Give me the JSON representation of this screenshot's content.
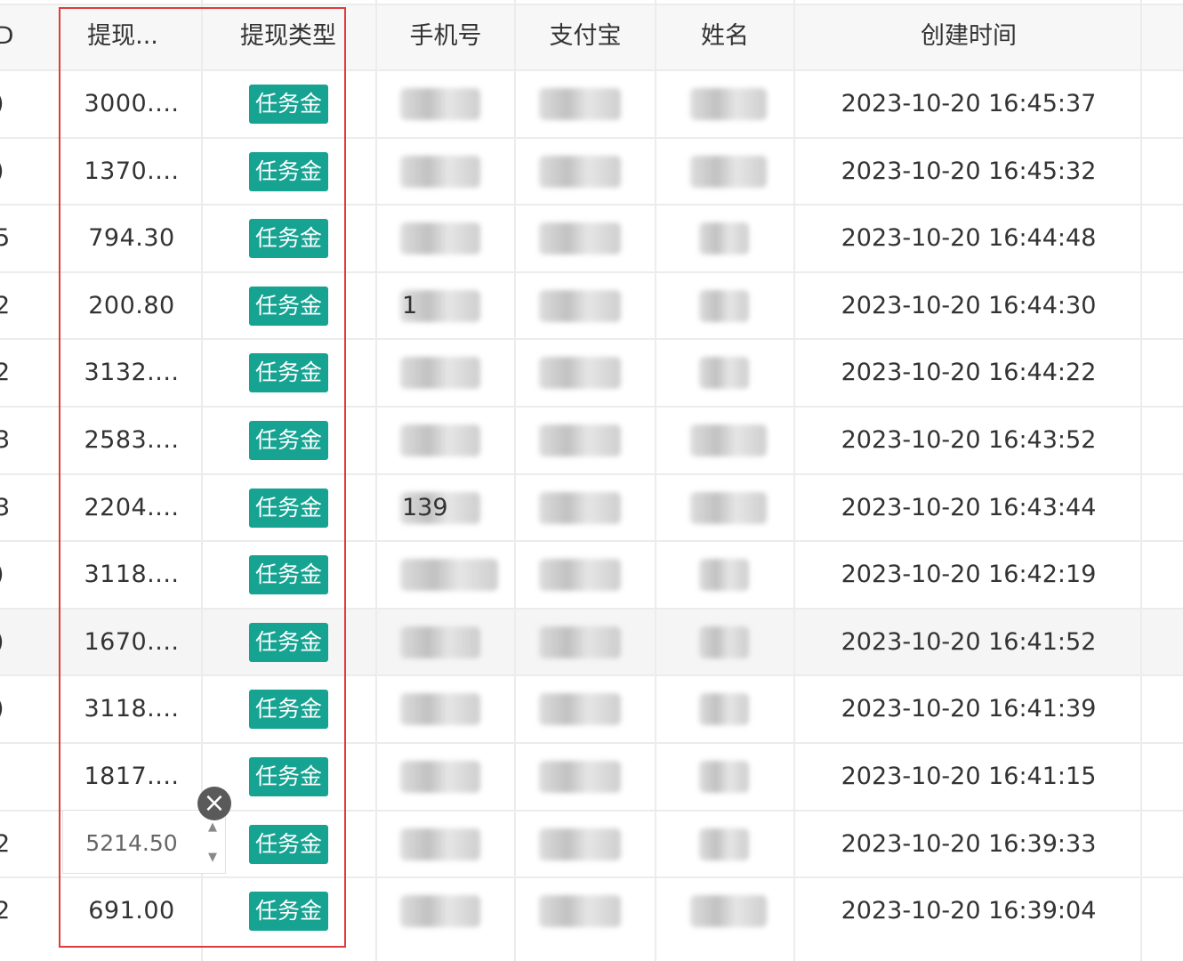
{
  "table": {
    "columns": {
      "id": "D",
      "amount": "提现...",
      "type": "提现类型",
      "phone": "手机号",
      "alipay": "支付宝",
      "name": "姓名",
      "created": "创建时间"
    },
    "rows": [
      {
        "id_tail": ")",
        "amount": "3000....",
        "type": "任务金",
        "phone_visible": "",
        "alipay_visible": "",
        "name_visible": "",
        "created": "2023-10-20 16:45:37"
      },
      {
        "id_tail": ")",
        "amount": "1370....",
        "type": "任务金",
        "phone_visible": "",
        "alipay_visible": "",
        "name_visible": "",
        "created": "2023-10-20 16:45:32"
      },
      {
        "id_tail": "5",
        "amount": "794.30",
        "type": "任务金",
        "phone_visible": "",
        "alipay_visible": "",
        "name_visible": "",
        "created": "2023-10-20 16:44:48"
      },
      {
        "id_tail": "2",
        "amount": "200.80",
        "type": "任务金",
        "phone_visible": "1",
        "alipay_visible": "",
        "name_visible": "",
        "created": "2023-10-20 16:44:30"
      },
      {
        "id_tail": "2",
        "amount": "3132....",
        "type": "任务金",
        "phone_visible": "",
        "alipay_visible": "",
        "name_visible": "",
        "created": "2023-10-20 16:44:22"
      },
      {
        "id_tail": "3",
        "amount": "2583....",
        "type": "任务金",
        "phone_visible": "",
        "alipay_visible": "",
        "name_visible": "",
        "created": "2023-10-20 16:43:52"
      },
      {
        "id_tail": "3",
        "amount": "2204....",
        "type": "任务金",
        "phone_visible": "139",
        "alipay_visible": "",
        "name_visible": "",
        "created": "2023-10-20 16:43:44"
      },
      {
        "id_tail": ")",
        "amount": "3118....",
        "type": "任务金",
        "phone_visible": "",
        "alipay_visible": "",
        "name_visible": "",
        "created": "2023-10-20 16:42:19"
      },
      {
        "id_tail": ")",
        "amount": "1670....",
        "type": "任务金",
        "phone_visible": "",
        "alipay_visible": "",
        "name_visible": "",
        "created": "2023-10-20 16:41:52"
      },
      {
        "id_tail": ")",
        "amount": "3118....",
        "type": "任务金",
        "phone_visible": "",
        "alipay_visible": "",
        "name_visible": "",
        "created": "2023-10-20 16:41:39"
      },
      {
        "id_tail": "",
        "amount": "1817....",
        "type": "任务金",
        "phone_visible": "",
        "alipay_visible": "",
        "name_visible": "",
        "created": "2023-10-20 16:41:15"
      },
      {
        "id_tail": "2",
        "amount": "5214.50",
        "type": "任务金",
        "phone_visible": "",
        "alipay_visible": "",
        "name_visible": "",
        "created": "2023-10-20 16:39:33"
      },
      {
        "id_tail": "2",
        "amount": "691.00",
        "type": "任务金",
        "phone_visible": "",
        "alipay_visible": "",
        "name_visible": "",
        "created": "2023-10-20 16:39:04"
      }
    ]
  },
  "editor": {
    "value": "5214.50",
    "clear_icon": "close-icon",
    "up_icon": "spin-up-icon",
    "down_icon": "spin-down-icon"
  },
  "colors": {
    "tag_bg": "#16a392",
    "highlight_border": "#e23b3b",
    "hover_row": "#f5f5f5",
    "header_bg": "#f7f7f7"
  }
}
